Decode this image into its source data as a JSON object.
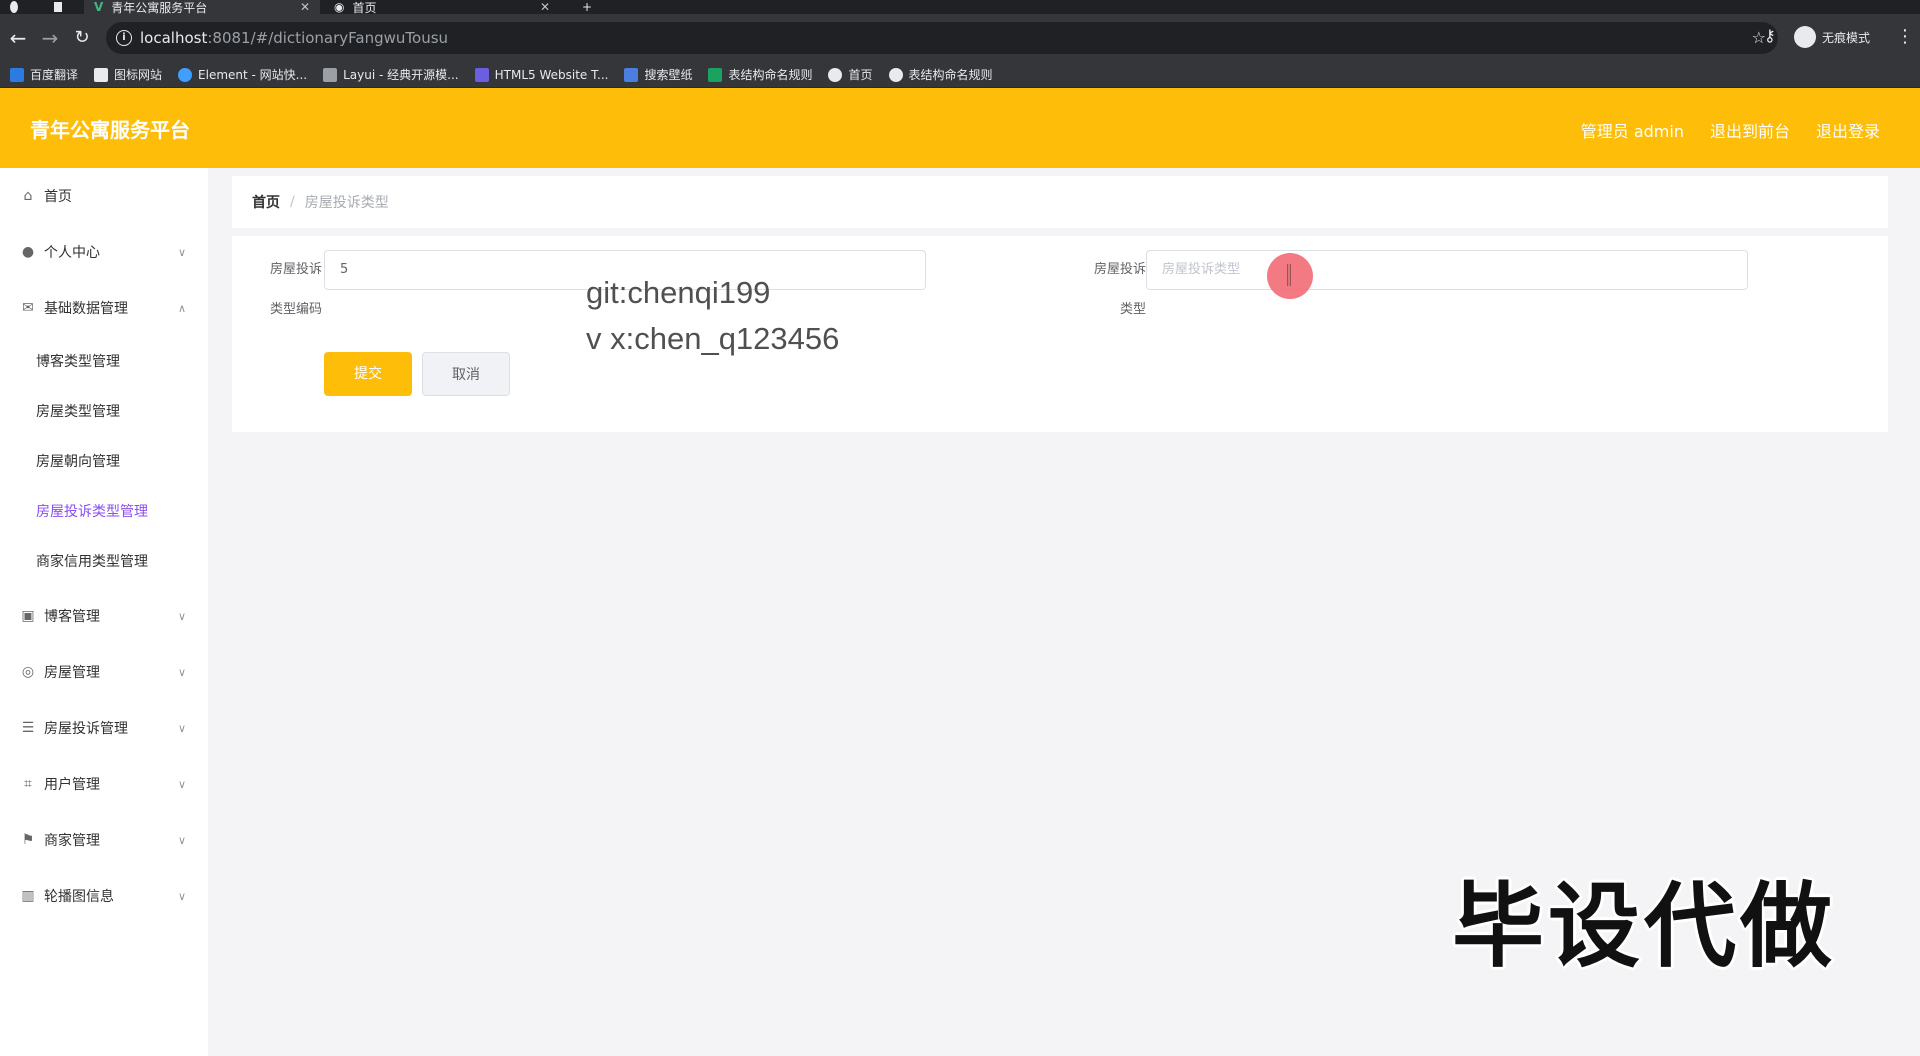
{
  "browser": {
    "tabs": [
      {
        "title": "青年公寓服务平台"
      },
      {
        "title": "首页"
      }
    ],
    "url_host": "localhost",
    "url_path": ":8081/#/dictionaryFangwuTousu",
    "incognito_label": "无痕模式",
    "bookmarks": [
      {
        "label": "百度翻译",
        "color": "#2b7be3"
      },
      {
        "label": "图标网站",
        "color": "#e8eaed"
      },
      {
        "label": "Element - 网站快...",
        "color": "#409eff"
      },
      {
        "label": "Layui - 经典开源模...",
        "color": "#9aa0a6"
      },
      {
        "label": "HTML5 Website T...",
        "color": "#6b5fe0"
      },
      {
        "label": "搜索壁纸",
        "color": "#4a7fe0"
      },
      {
        "label": "表结构命名规则",
        "color": "#1aa260"
      },
      {
        "label": "首页",
        "color": "#e8eaed"
      },
      {
        "label": "表结构命名规则",
        "color": "#e8eaed"
      }
    ]
  },
  "header": {
    "title": "青年公寓服务平台",
    "admin_label": "管理员 admin",
    "front_label": "退出到前台",
    "logout_label": "退出登录",
    "accent": "#fdbd08"
  },
  "sidebar": {
    "items": [
      {
        "label": "首页",
        "icon": "home-icon"
      },
      {
        "label": "个人中心",
        "icon": "user-icon"
      },
      {
        "label": "基础数据管理",
        "icon": "mail-icon"
      },
      {
        "label": "博客管理",
        "icon": "clipboard-icon"
      },
      {
        "label": "房屋管理",
        "icon": "compass-icon"
      },
      {
        "label": "房屋投诉管理",
        "icon": "sliders-icon"
      },
      {
        "label": "用户管理",
        "icon": "crop-icon"
      },
      {
        "label": "商家管理",
        "icon": "flag-icon"
      },
      {
        "label": "轮播图信息",
        "icon": "chart-icon"
      }
    ],
    "subitems": [
      {
        "label": "博客类型管理"
      },
      {
        "label": "房屋类型管理"
      },
      {
        "label": "房屋朝向管理"
      },
      {
        "label": "房屋投诉类型管理"
      },
      {
        "label": "商家信用类型管理"
      }
    ],
    "active_color": "#8a4ff0"
  },
  "breadcrumb": {
    "home": "首页",
    "separator": "/",
    "current": "房屋投诉类型"
  },
  "form": {
    "code_label_1": "房屋投诉",
    "code_label_2": "类型编码",
    "code_value": "5",
    "type_label_1": "房屋投诉",
    "type_label_2": "类型",
    "type_placeholder": "房屋投诉类型",
    "submit_label": "提交",
    "cancel_label": "取消"
  },
  "overlay": {
    "watermark_line1": "git:chenqi199",
    "watermark_line2": "v x:chen_q123456",
    "promo": "毕设代做"
  }
}
